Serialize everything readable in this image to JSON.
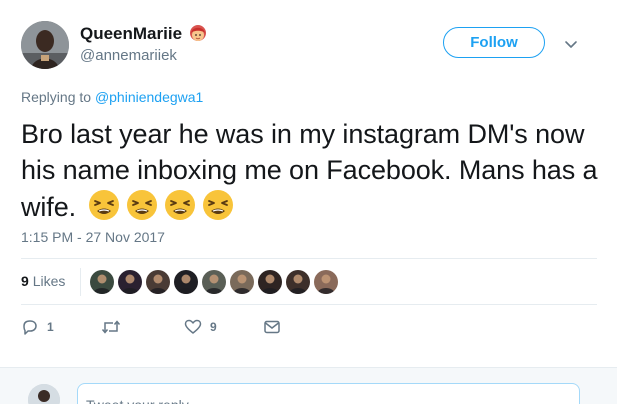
{
  "user": {
    "display_name": "QueenMariie",
    "name_emoji": "woman-red-hair-emoji",
    "handle": "@annemariiek"
  },
  "follow": {
    "label": "Follow"
  },
  "menu": {
    "icon": "chevron-down-icon"
  },
  "reply_context": {
    "prefix": "Replying to",
    "mention": "@phiniendegwa1"
  },
  "tweet": {
    "text": "Bro last year he was in my instagram DM's now his name inboxing me on Facebook. Mans has a wife.",
    "emojis": [
      "tired-face-emoji",
      "tired-face-emoji",
      "tired-face-emoji",
      "tired-face-emoji"
    ]
  },
  "timestamp": "1:15 PM - 27 Nov 2017",
  "likes": {
    "count": "9",
    "label": "Likes",
    "likers": [
      {
        "name": "liker-avatar",
        "color": "#3b4a3f"
      },
      {
        "name": "liker-avatar",
        "color": "#2a2030"
      },
      {
        "name": "liker-avatar",
        "color": "#4a3b35"
      },
      {
        "name": "liker-avatar",
        "color": "#1f1f24"
      },
      {
        "name": "liker-avatar",
        "color": "#5a5f56"
      },
      {
        "name": "liker-avatar",
        "color": "#7a6a5a"
      },
      {
        "name": "liker-avatar",
        "color": "#2e2422"
      },
      {
        "name": "liker-avatar",
        "color": "#3d2f2a"
      },
      {
        "name": "liker-avatar",
        "color": "#8a6a5a"
      }
    ]
  },
  "actions": {
    "reply_count": "1",
    "retweet_count": "",
    "like_count": "9"
  },
  "reply_box": {
    "placeholder": "Tweet your reply"
  },
  "colors": {
    "accent": "#1da1f2",
    "muted": "#657786",
    "divider": "#e6ecf0"
  }
}
